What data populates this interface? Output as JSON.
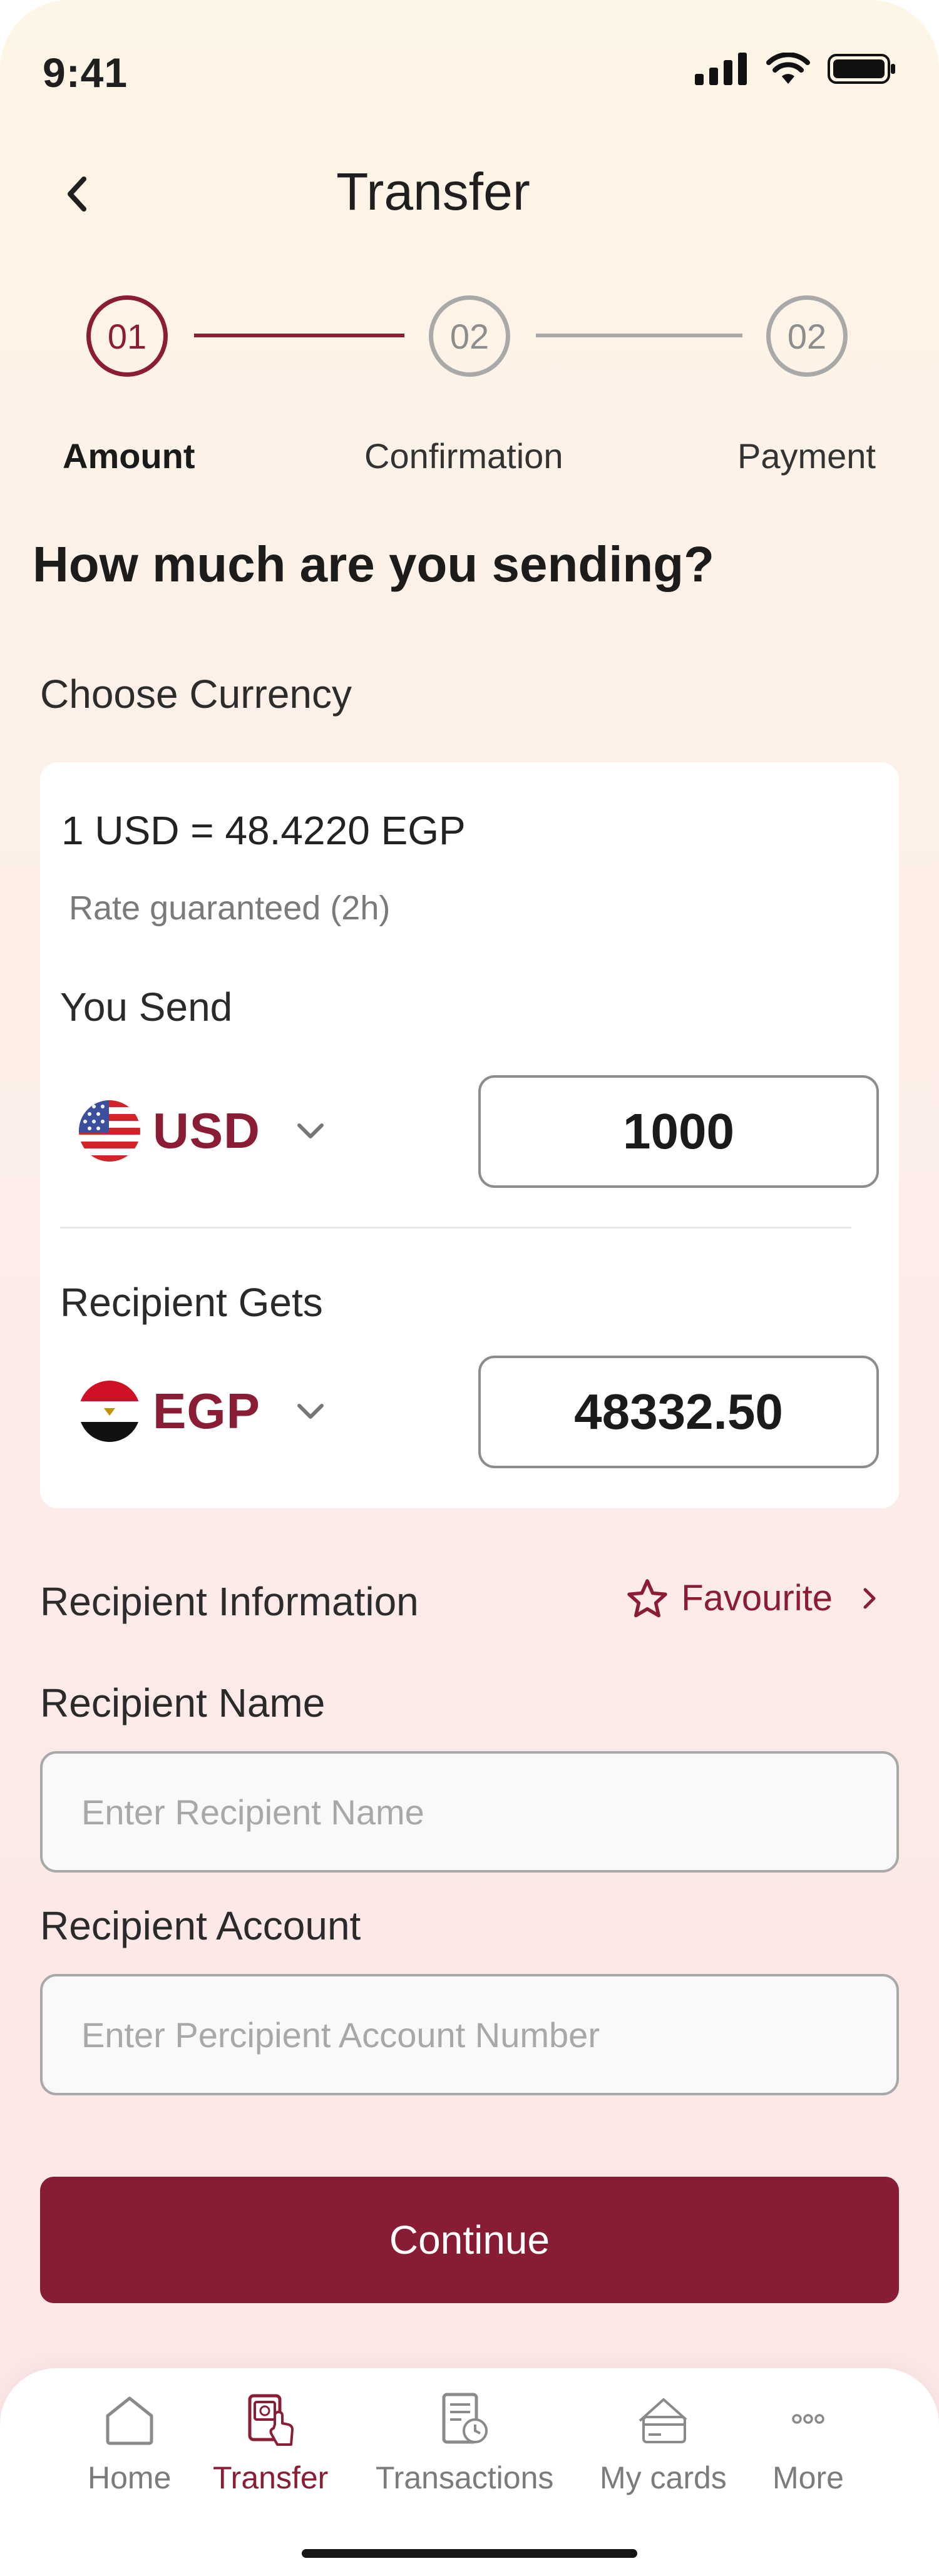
{
  "status_bar": {
    "time": "9:41"
  },
  "header": {
    "title": "Transfer"
  },
  "stepper": {
    "steps": [
      {
        "number": "01",
        "label": "Amount",
        "state": "active"
      },
      {
        "number": "02",
        "label": "Confirmation",
        "state": "inactive"
      },
      {
        "number": "02",
        "label": "Payment",
        "state": "inactive"
      }
    ]
  },
  "main": {
    "heading": "How much are you sending?",
    "choose_currency_label": "Choose Currency"
  },
  "currency_card": {
    "rate": "1 USD = 48.4220 EGP",
    "rate_note": "Rate guaranteed (2h)",
    "send": {
      "label": "You Send",
      "currency": "USD",
      "amount": "1000"
    },
    "receive": {
      "label": "Recipient Gets",
      "currency": "EGP",
      "amount": "48332.50"
    }
  },
  "recipient": {
    "section_title": "Recipient Information",
    "favourite_label": "Favourite",
    "name_label": "Recipient Name",
    "name_placeholder": "Enter Recipient Name",
    "account_label": "Recipient Account",
    "account_placeholder": "Enter Percipient Account Number"
  },
  "actions": {
    "continue_label": "Continue"
  },
  "bottom_nav": {
    "items": [
      {
        "label": "Home",
        "icon": "home-icon",
        "active": false
      },
      {
        "label": "Transfer",
        "icon": "transfer-icon",
        "active": true
      },
      {
        "label": "Transactions",
        "icon": "transactions-icon",
        "active": false
      },
      {
        "label": "My cards",
        "icon": "cards-icon",
        "active": false
      },
      {
        "label": "More",
        "icon": "more-icon",
        "active": false
      }
    ]
  },
  "colors": {
    "accent": "#8a1c33",
    "inactive": "#a9a9a9",
    "card": "#ffffff"
  }
}
